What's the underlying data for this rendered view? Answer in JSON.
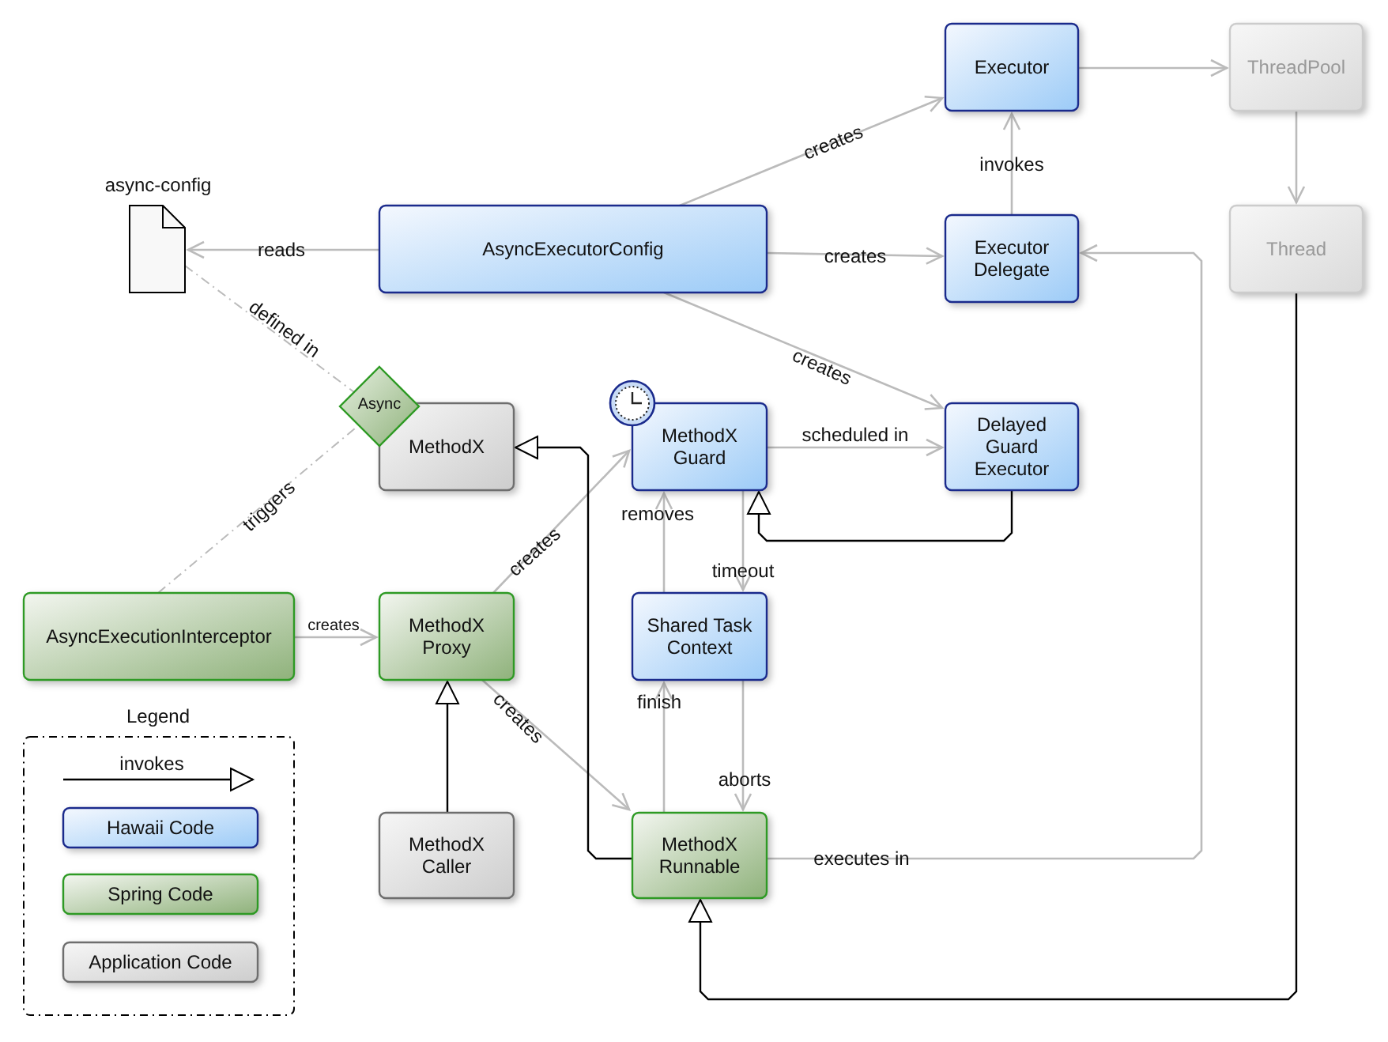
{
  "diagram": {
    "document": {
      "label": "async-config"
    },
    "annotation": {
      "label": "Async"
    },
    "nodes": [
      {
        "lines": [
          "Executor"
        ],
        "kind": "hawaii"
      },
      {
        "lines": [
          "ThreadPool"
        ],
        "kind": "external"
      },
      {
        "lines": [
          "AsyncExecutorConfig"
        ],
        "kind": "hawaii"
      },
      {
        "lines": [
          "Executor",
          "Delegate"
        ],
        "kind": "hawaii"
      },
      {
        "lines": [
          "Thread"
        ],
        "kind": "external"
      },
      {
        "lines": [
          "MethodX"
        ],
        "kind": "application"
      },
      {
        "lines": [
          "MethodX",
          "Guard"
        ],
        "kind": "hawaii",
        "timer": true
      },
      {
        "lines": [
          "Delayed",
          "Guard",
          "Executor"
        ],
        "kind": "hawaii"
      },
      {
        "lines": [
          "AsyncExecutionInterceptor"
        ],
        "kind": "spring"
      },
      {
        "lines": [
          "MethodX",
          "Proxy"
        ],
        "kind": "spring"
      },
      {
        "lines": [
          "Shared Task",
          "Context"
        ],
        "kind": "hawaii"
      },
      {
        "lines": [
          "MethodX",
          "Caller"
        ],
        "kind": "application"
      },
      {
        "lines": [
          "MethodX",
          "Runnable"
        ],
        "kind": "spring"
      }
    ],
    "edges": [
      {
        "kind": "uses",
        "label": "creates"
      },
      {
        "kind": "uses",
        "label": "creates"
      },
      {
        "kind": "uses",
        "label": "creates"
      },
      {
        "kind": "uses",
        "label": "reads"
      },
      {
        "kind": "uses",
        "label": "invokes"
      },
      {
        "kind": "uses"
      },
      {
        "kind": "uses"
      },
      {
        "kind": "uses",
        "label": "scheduled in"
      },
      {
        "kind": "uses",
        "label": "creates"
      },
      {
        "kind": "uses",
        "label": "creates"
      },
      {
        "kind": "uses",
        "label": "creates"
      },
      {
        "kind": "uses",
        "label": "removes"
      },
      {
        "kind": "uses",
        "label": "timeout"
      },
      {
        "kind": "uses",
        "label": "finish"
      },
      {
        "kind": "uses",
        "label": "aborts"
      },
      {
        "kind": "uses",
        "label": "executes in"
      },
      {
        "kind": "inherits"
      },
      {
        "kind": "inherits"
      },
      {
        "kind": "inherits"
      },
      {
        "kind": "inherits"
      },
      {
        "kind": "annotates",
        "label": "defined in"
      },
      {
        "kind": "annotates",
        "label": "triggers"
      }
    ]
  },
  "legend": {
    "title": "Legend",
    "arrow_label": "invokes",
    "items": [
      {
        "label": "Hawaii Code",
        "kind": "hawaii"
      },
      {
        "label": "Spring Code",
        "kind": "spring"
      },
      {
        "label": "Application Code",
        "kind": "application"
      }
    ]
  }
}
